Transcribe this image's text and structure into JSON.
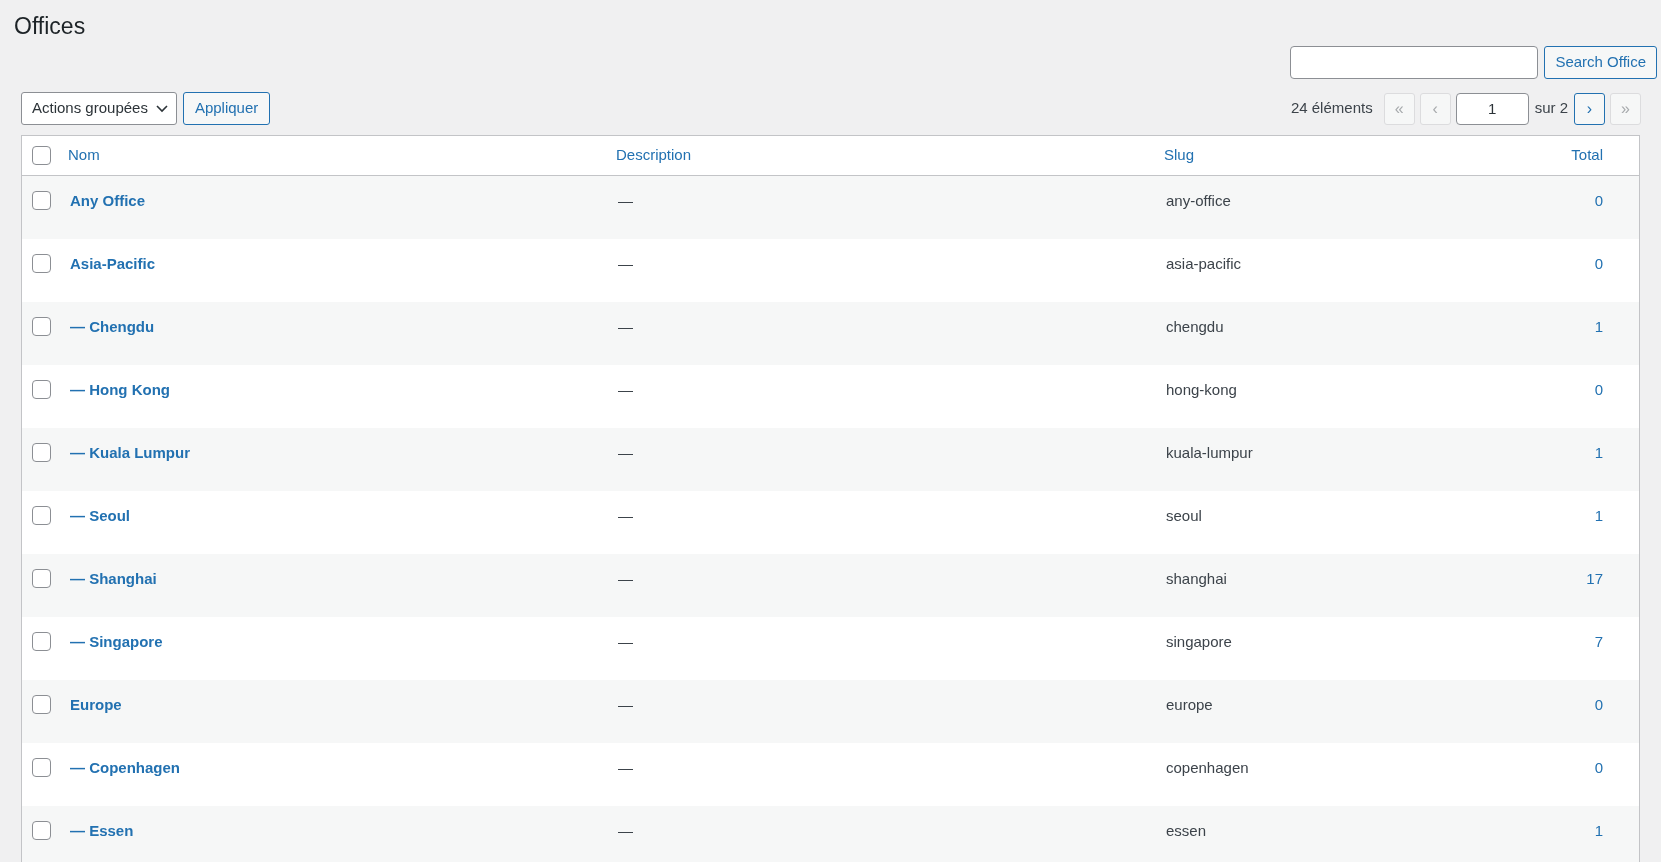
{
  "title": "Offices",
  "search": {
    "button": "Search Office"
  },
  "bulk": {
    "select": "Actions groupées",
    "apply": "Appliquer"
  },
  "pagination": {
    "count": "24 éléments",
    "first": {
      "label": "«",
      "disabled": true
    },
    "prev": {
      "label": "‹",
      "disabled": true
    },
    "page": "1",
    "of": "sur 2",
    "next": {
      "label": "›",
      "disabled": false
    },
    "last": {
      "label": "»",
      "disabled": true
    }
  },
  "table": {
    "select_all_checked": false,
    "columns": [
      "Nom",
      "Description",
      "Slug",
      "Total"
    ],
    "rows": [
      {
        "name": "Any Office",
        "description": "—",
        "slug": "any-office",
        "total": "0",
        "checked": false
      },
      {
        "name": "Asia-Pacific",
        "description": "—",
        "slug": "asia-pacific",
        "total": "0",
        "checked": false,
        "children": [
          {
            "name": "— Chengdu",
            "description": "—",
            "slug": "chengdu",
            "total": "1",
            "checked": false
          },
          {
            "name": "— Hong Kong",
            "description": "—",
            "slug": "hong-kong",
            "total": "0",
            "checked": false
          },
          {
            "name": "— Kuala Lumpur",
            "description": "—",
            "slug": "kuala-lumpur",
            "total": "1",
            "checked": false
          },
          {
            "name": "— Seoul",
            "description": "—",
            "slug": "seoul",
            "total": "1",
            "checked": false
          },
          {
            "name": "— Shanghai",
            "description": "—",
            "slug": "shanghai",
            "total": "17",
            "checked": false
          },
          {
            "name": "— Singapore",
            "description": "—",
            "slug": "singapore",
            "total": "7",
            "checked": false
          }
        ]
      },
      {
        "name": "Europe",
        "description": "—",
        "slug": "europe",
        "total": "0",
        "checked": false,
        "children": [
          {
            "name": "— Copenhagen",
            "description": "—",
            "slug": "copenhagen",
            "total": "0",
            "checked": false
          },
          {
            "name": "— Essen",
            "description": "—",
            "slug": "essen",
            "total": "1",
            "checked": false
          }
        ]
      }
    ]
  }
}
